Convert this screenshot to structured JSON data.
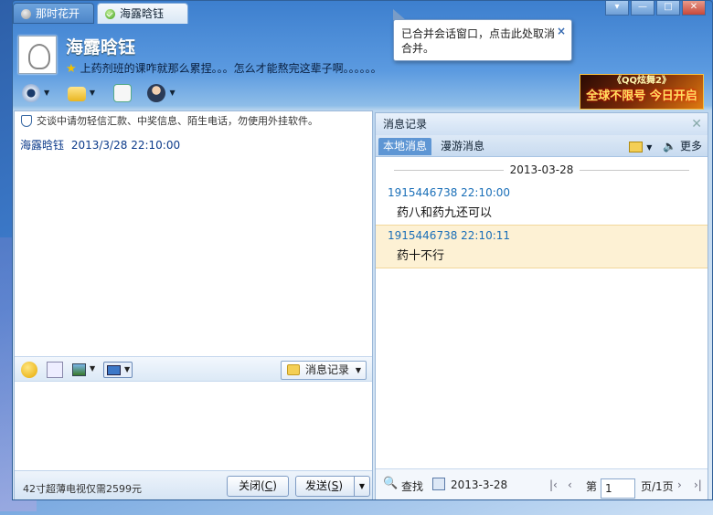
{
  "tabs": [
    {
      "label": "那时花开"
    },
    {
      "label": "海露晗钰"
    }
  ],
  "window_controls": {
    "min": "—",
    "max": "□",
    "close": "✕"
  },
  "contact": {
    "name": "海露晗钰",
    "signature": "上药剂班的课咋就那么累捏。。。怎么才能熬完这辈子啊。。。。。。"
  },
  "tooltip": {
    "text": "已合并会话窗口，点击此处取消合并。",
    "close": "×"
  },
  "ad": {
    "line1": "《QQ炫舞2》",
    "line2": "全球不限号 今日开启"
  },
  "chat": {
    "security_notice": "交谈中请勿轻信汇款、中奖信息、陌生电话，勿使用外挂软件。",
    "message": {
      "sender": "海露晗钰",
      "time": "2013/3/28 22:10:00"
    },
    "history_button": "消息记录",
    "promo": "42寸超薄电视仅需2599元",
    "close_label": "关闭(",
    "close_key": "C",
    "send_label": "发送(",
    "send_key": "S"
  },
  "history": {
    "title": "消息记录",
    "tab_local": "本地消息",
    "tab_roam": "漫游消息",
    "more": "更多",
    "date": "2013-03-28",
    "entries": [
      {
        "who": "1915446738 22:10:00",
        "text": "药八和药九还可以"
      },
      {
        "who": "1915446738 22:10:11",
        "text": "药十不行"
      }
    ],
    "search": "查找",
    "date_filter": "2013-3-28",
    "page_prefix": "第",
    "page_value": "1",
    "page_suffix": "页/1页"
  }
}
